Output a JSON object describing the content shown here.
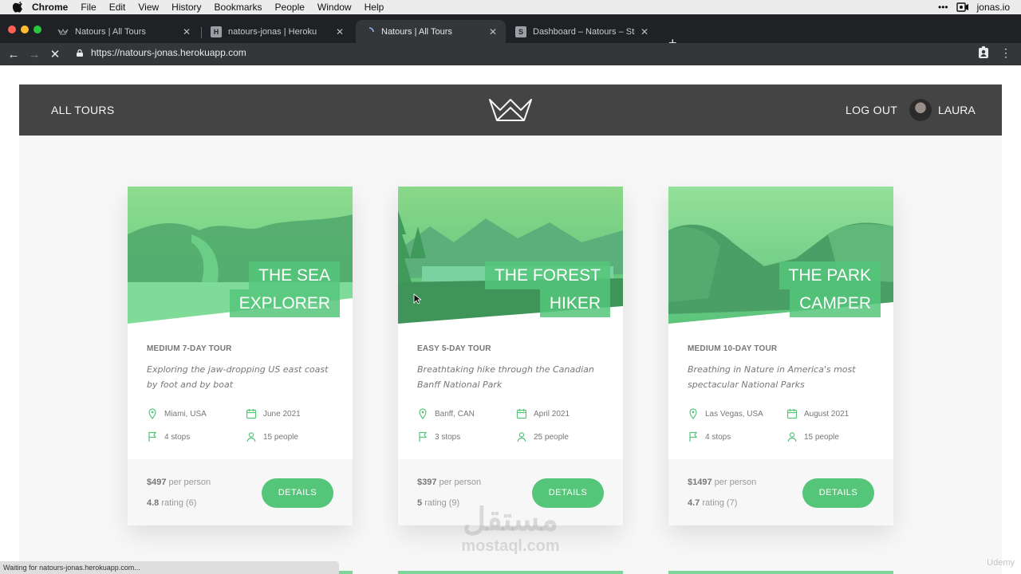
{
  "menubar": {
    "items": [
      "Chrome",
      "File",
      "Edit",
      "View",
      "History",
      "Bookmarks",
      "People",
      "Window",
      "Help"
    ],
    "right_label": "jonas.io"
  },
  "tabs": [
    {
      "title": "Natours | All Tours",
      "icon": "natours-logo-icon"
    },
    {
      "title": "natours-jonas | Heroku",
      "icon": "heroku-icon",
      "favicon_text": "H"
    },
    {
      "title": "Natours | All Tours",
      "icon": "loading-spinner-icon"
    },
    {
      "title": "Dashboard – Natours – Stripe",
      "icon": "stripe-icon",
      "favicon_text": "S"
    }
  ],
  "address": {
    "url": "https://natours-jonas.herokuapp.com"
  },
  "header": {
    "nav_all_tours": "ALL TOURS",
    "logout": "LOG OUT",
    "user_name": "LAURA"
  },
  "tours": [
    {
      "name_line1": "THE SEA",
      "name_line2": "EXPLORER",
      "subheading": "MEDIUM 7-DAY TOUR",
      "summary": "Exploring the jaw-dropping US east coast by foot and by boat",
      "location": "Miami, USA",
      "date": "June 2021",
      "stops": "4 stops",
      "people": "15 people",
      "price": "$497",
      "price_suffix": "per person",
      "rating": "4.8",
      "rating_suffix": "rating (6)",
      "button": "DETAILS"
    },
    {
      "name_line1": "THE FOREST",
      "name_line2": "HIKER",
      "subheading": "EASY 5-DAY TOUR",
      "summary": "Breathtaking hike through the Canadian Banff National Park",
      "location": "Banff, CAN",
      "date": "April 2021",
      "stops": "3 stops",
      "people": "25 people",
      "price": "$397",
      "price_suffix": "per person",
      "rating": "5",
      "rating_suffix": "rating (9)",
      "button": "DETAILS"
    },
    {
      "name_line1": "THE PARK",
      "name_line2": "CAMPER",
      "subheading": "MEDIUM 10-DAY TOUR",
      "summary": "Breathing in Nature in America's most spectacular National Parks",
      "location": "Las Vegas, USA",
      "date": "August 2021",
      "stops": "4 stops",
      "people": "15 people",
      "price": "$1497",
      "price_suffix": "per person",
      "rating": "4.7",
      "rating_suffix": "rating (7)",
      "button": "DETAILS"
    }
  ],
  "status_bar": "Waiting for natours-jonas.herokuapp.com...",
  "watermark": {
    "arabic": "مستقل",
    "latin": "mostaql.com",
    "udemy": "Udemy"
  },
  "colors": {
    "accent": "#55c57a",
    "header_bg": "#444444",
    "page_bg": "#f7f7f7"
  }
}
